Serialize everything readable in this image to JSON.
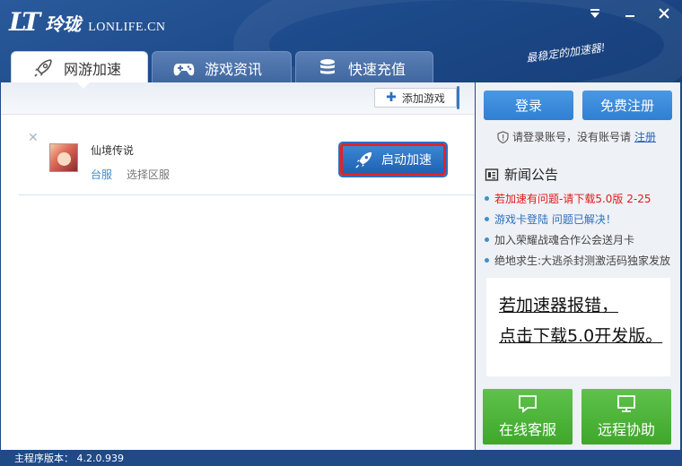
{
  "window": {
    "logo_mark": "LT",
    "logo_cn": "玲珑",
    "logo_en": "LONLIFE.CN",
    "slogan": "最稳定的加速器!"
  },
  "tabs": [
    {
      "label": "网游加速",
      "icon": "rocket-icon",
      "active": true
    },
    {
      "label": "游戏资讯",
      "icon": "gamepad-icon",
      "active": false
    },
    {
      "label": "快速充值",
      "icon": "coins-icon",
      "active": false
    }
  ],
  "toolbar": {
    "add_game_label": "添加游戏"
  },
  "games": [
    {
      "name": "仙境传说",
      "server": "台服",
      "region_label": "选择区服",
      "launch_label": "启动加速"
    }
  ],
  "account": {
    "login_label": "登录",
    "register_label": "免费注册",
    "hint": "请登录账号，没有账号请",
    "register_link": "注册"
  },
  "news": {
    "title": "新闻公告",
    "items": [
      {
        "text": "若加速有问题-请下载5.0版 2-25",
        "color": "#e01b1b"
      },
      {
        "text": "游戏卡登陆 问题已解决！",
        "color": "#2a6fc0"
      },
      {
        "text": "加入荣耀战魂合作公会送月卡",
        "color": "#444444"
      },
      {
        "text": "绝地求生:大逃杀封测激活码独家发放",
        "color": "#444444"
      }
    ]
  },
  "ad": {
    "line1": "若加速器报错，",
    "line2": "点击下载5.0开发版。"
  },
  "support": {
    "chat_label": "在线客服",
    "remote_label": "远程协助"
  },
  "status": {
    "version_text": "主程序版本： 4.2.0.939"
  },
  "colors": {
    "accent_blue": "#2f7fd3",
    "green": "#4cb43a",
    "alert_red": "#e01b1b",
    "header": "#1f4a86"
  }
}
